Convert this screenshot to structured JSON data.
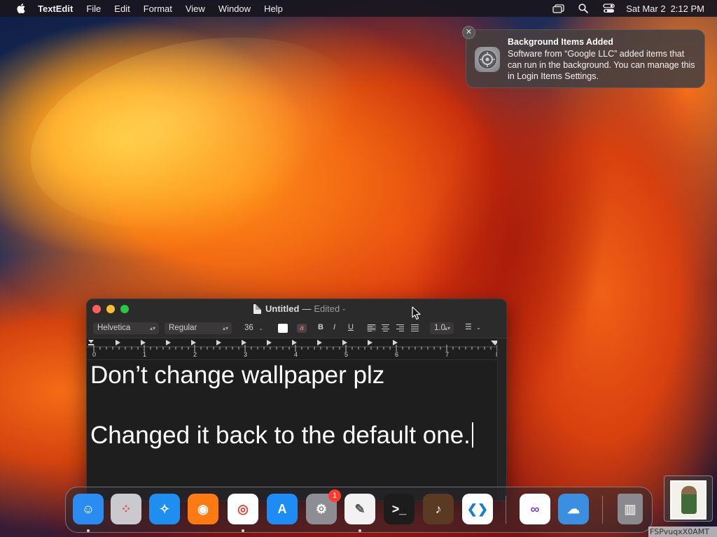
{
  "menubar": {
    "app_name": "TextEdit",
    "menus": [
      "File",
      "Edit",
      "Format",
      "View",
      "Window",
      "Help"
    ],
    "status_icons": [
      "screen-mirroring-icon",
      "spotlight-search-icon",
      "control-center-icon"
    ],
    "date": "Sat Mar 2",
    "time": "2:12 PM"
  },
  "notification": {
    "title": "Background Items Added",
    "body": "Software from “Google LLC” added items that can run in the background. You can manage this in Login Items Settings.",
    "icon": "system-settings-icon",
    "close_label": "✕"
  },
  "window": {
    "title": "Untitled",
    "separator": "—",
    "status": "Edited",
    "chevron": "⌄",
    "toolbar": {
      "font_family": "Helvetica",
      "font_style": "Regular",
      "font_size": "36",
      "text_color": "#ffffff",
      "highlight_label": "a",
      "bold_label": "B",
      "italic_label": "I",
      "underline_label": "U",
      "line_spacing": "1.0",
      "list_label": "☰",
      "active_alignment": "left"
    },
    "ruler_numbers": [
      "0",
      "1",
      "2",
      "3",
      "4",
      "5",
      "6",
      "7",
      "8"
    ],
    "document_lines": [
      "Don’t change wallpaper plz",
      "",
      "Changed it back to the default one."
    ]
  },
  "dock": {
    "apps": [
      {
        "name": "Finder",
        "color": "#2a8cf0",
        "running": true
      },
      {
        "name": "Launchpad",
        "color": "#c9c9cf",
        "running": false
      },
      {
        "name": "Safari",
        "color": "#1f8ef1",
        "running": false
      },
      {
        "name": "Firefox",
        "color": "#ff7a12",
        "running": false
      },
      {
        "name": "Google Chrome",
        "color": "#ffffff",
        "running": true
      },
      {
        "name": "App Store",
        "color": "#1e8cf5",
        "running": false
      },
      {
        "name": "System Settings",
        "color": "#8d8d93",
        "running": false,
        "badge": "1"
      },
      {
        "name": "TextEdit",
        "color": "#f2f2f2",
        "running": true
      },
      {
        "name": "Terminal",
        "color": "#1c1c1c",
        "running": false
      },
      {
        "name": "GarageBand",
        "color": "#5a3a22",
        "running": false
      },
      {
        "name": "Visual Studio Code",
        "color": "#ffffff",
        "running": false
      },
      {
        "name": "Visual Studio",
        "color": "#ffffff",
        "running": false
      },
      {
        "name": "Weather",
        "color": "#3a8fe0",
        "running": false
      },
      {
        "name": "Trash",
        "color": "#8a8a8e",
        "running": false
      }
    ]
  },
  "watermark": "FSPvuqxX0AMT"
}
